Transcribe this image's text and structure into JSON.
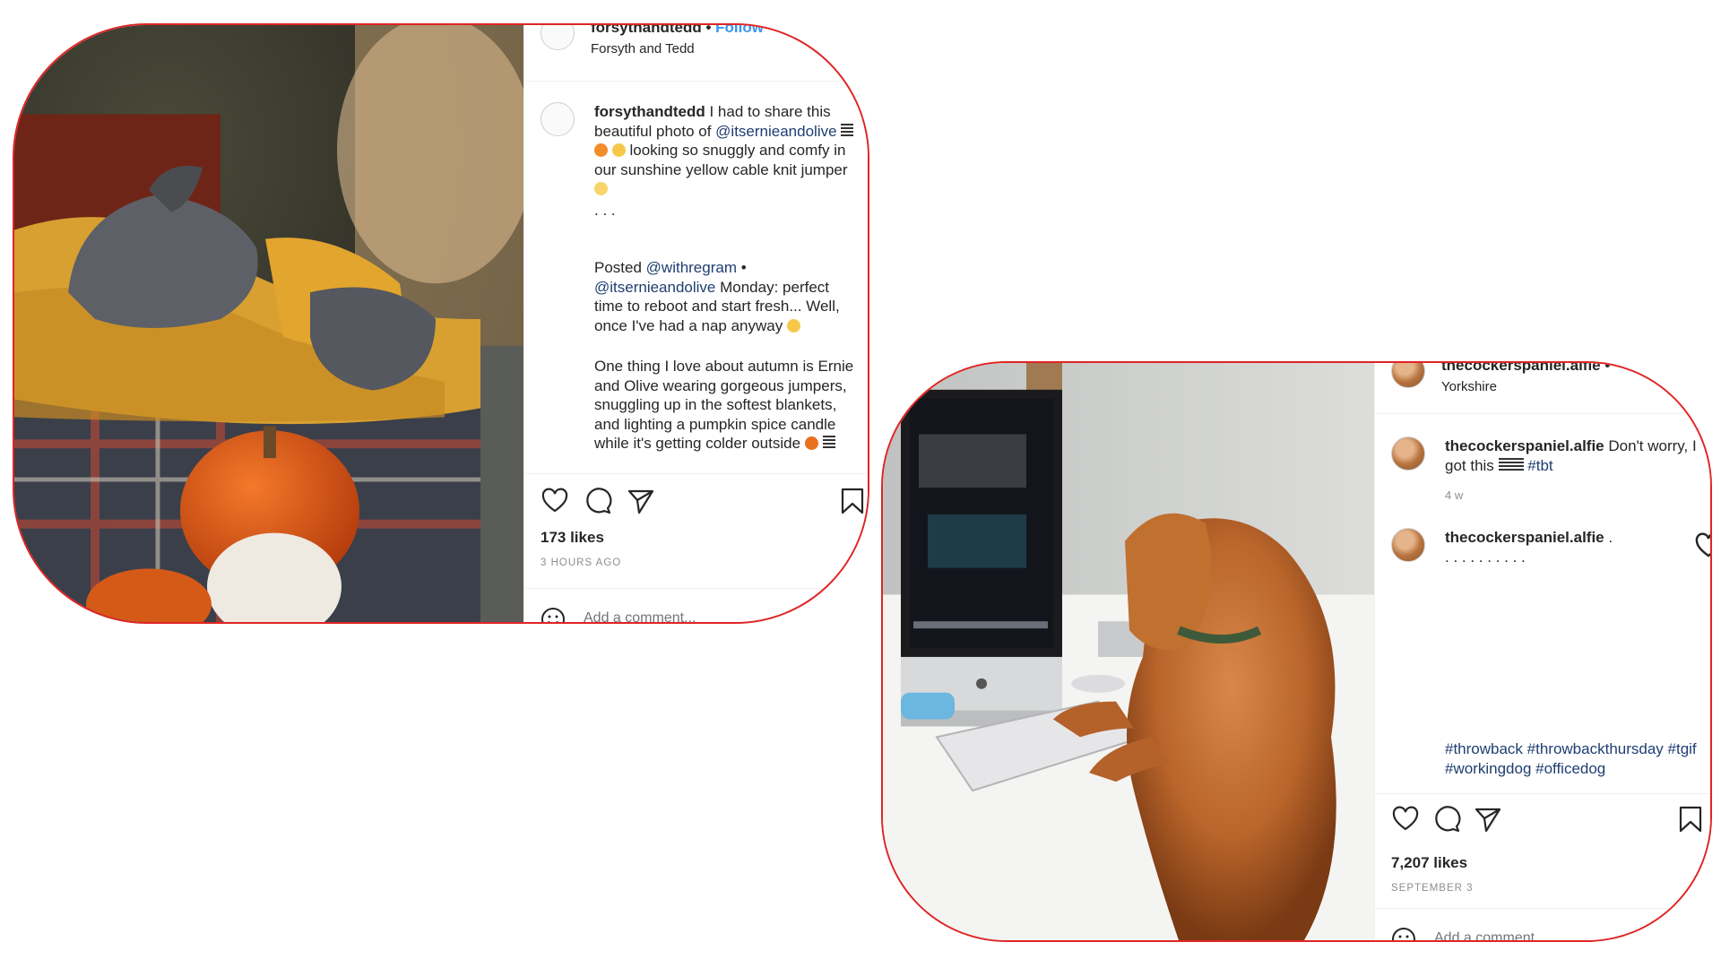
{
  "post1": {
    "username": "forsythandtedd",
    "follow_label": "Follow",
    "location": "Forsyth and Tedd",
    "caption_user": "forsythandtedd",
    "caption_text_1": " I had to share this beautiful photo of ",
    "caption_mention_1": "@itsernieandolive",
    "caption_text_2": " looking so snuggly and comfy in our sunshine yellow cable knit jumper",
    "dots": ".\n.\n.",
    "posted_label": "Posted ",
    "posted_via": "@withregram",
    "posted_sep": " •",
    "repost_mention": "@itsernieandolive",
    "repost_text": " Monday: perfect time to reboot and start fresh... Well, once I've had a nap anyway",
    "paragraph_2": "One thing I love about autumn is Ernie and Olive wearing gorgeous jumpers, snuggling up in the softest blankets, and lighting a pumpkin spice candle while it's getting colder outside",
    "likes": "173 likes",
    "time": "3 HOURS AGO",
    "comment_placeholder": "Add a comment..."
  },
  "post2": {
    "username": "thecockerspaniel.alfie",
    "location": "Yorkshire",
    "caption_user": "thecockerspaniel.alfie",
    "caption_text": " Don't worry, I got this",
    "caption_tag": "#tbt",
    "caption_age": "4 w",
    "comment_user": "thecockerspaniel.alfie",
    "comment_text": " .",
    "dots": ".\n.\n.\n.\n.\n.\n.\n.\n.\n.",
    "hashtags": "#throwback #throwbackthursday #tgif #workingdog #officedog",
    "likes": "7,207 likes",
    "time": "SEPTEMBER 3",
    "comment_placeholder": "Add a comment..."
  },
  "icons": [
    "heart-icon",
    "comment-icon",
    "share-icon",
    "bookmark-icon",
    "smiley-icon"
  ],
  "colors": {
    "frame": "#e02424",
    "link": "#1f3e72",
    "follow": "#3897f0",
    "muted": "#8e8e8e"
  }
}
